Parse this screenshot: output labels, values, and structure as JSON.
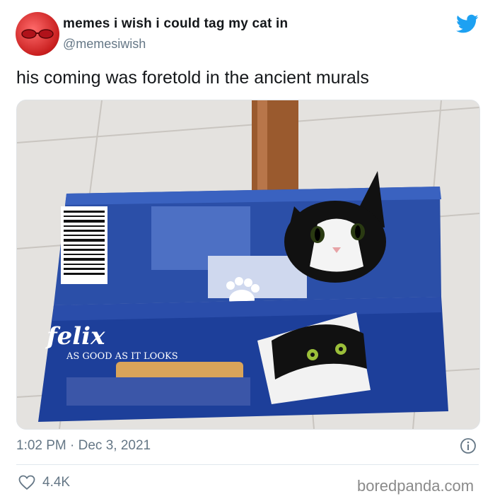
{
  "account": {
    "display_name": "memes i wish i could tag my cat in",
    "handle": "@memesiwish"
  },
  "tweet": {
    "text": "his coming was foretold in the ancient murals",
    "timestamp": "1:02 PM · Dec 3, 2021",
    "likes": "4.4K"
  },
  "photo": {
    "box_brand": "felix",
    "box_slogan": "AS GOOD AS IT LOOKS"
  },
  "watermark": "boredpanda.com",
  "icons": {
    "platform": "twitter-bird-icon",
    "info": "info-icon",
    "like": "heart-icon"
  },
  "colors": {
    "twitter_blue": "#1da1f2",
    "secondary_text": "#657786",
    "box_blue": "#1d3f9a"
  }
}
